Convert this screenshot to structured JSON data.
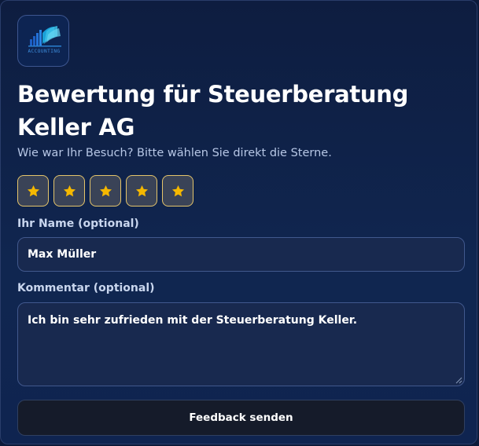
{
  "header": {
    "logo_icon": "accounting-logo-icon",
    "logo_text": "ACCOUNTING",
    "title": "Bewertung für Steuerberatung Keller AG",
    "subtitle": "Wie war Ihr Besuch? Bitte wählen Sie direkt die Sterne."
  },
  "rating": {
    "max": 5,
    "selected": 5,
    "star_icon": "star-icon",
    "star_color": "#f5b800",
    "button_border_color": "#e4c46a"
  },
  "form": {
    "name_label": "Ihr Name (optional)",
    "name_value": "Max Müller",
    "comment_label": "Kommentar (optional)",
    "comment_value": "Ich bin sehr zufrieden mit der Steuerberatung Keller."
  },
  "submit": {
    "label": "Feedback senden"
  },
  "colors": {
    "background": "#0e1d40",
    "text_primary": "#ffffff",
    "text_secondary": "#b7c7e6",
    "input_background": "#18294f",
    "input_border": "#41588d",
    "submit_background": "#151b2a"
  }
}
